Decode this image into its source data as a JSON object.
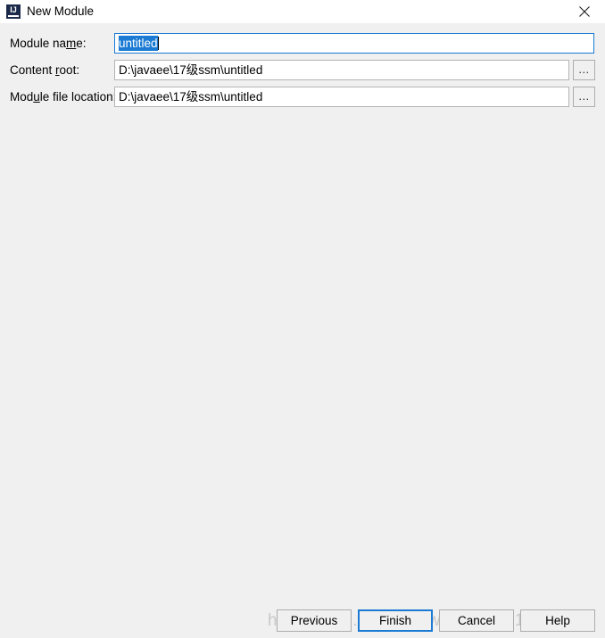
{
  "window": {
    "title": "New Module",
    "icon": "intellij-idea-icon",
    "icon_text": "IJ",
    "close_icon": "close-icon",
    "background_color": "#f0f0f0",
    "titlebar_color": "#ffffff",
    "accent_color": "#1a7ad4"
  },
  "form": {
    "rows": [
      {
        "label_prefix": "Module na",
        "label_mnemonic": "m",
        "label_suffix": "e:",
        "value": "untitled",
        "value_selected": true,
        "focused": true,
        "has_browse": false,
        "browse_label": ""
      },
      {
        "label_prefix": "Content ",
        "label_mnemonic": "r",
        "label_suffix": "oot:",
        "value": "D:\\javaee\\17级ssm\\untitled",
        "value_selected": false,
        "focused": false,
        "has_browse": true,
        "browse_label": "..."
      },
      {
        "label_prefix": "Mod",
        "label_mnemonic": "u",
        "label_suffix": "le file location:",
        "value": "D:\\javaee\\17级ssm\\untitled",
        "value_selected": false,
        "focused": false,
        "has_browse": true,
        "browse_label": "..."
      }
    ]
  },
  "footer": {
    "buttons": [
      {
        "label": "Previous",
        "default": false
      },
      {
        "label": "Finish",
        "default": true
      },
      {
        "label": "Cancel",
        "default": false
      },
      {
        "label": "Help",
        "default": false
      }
    ]
  },
  "watermark": {
    "text": "https://blog.csdn.net/weixin_44418154"
  }
}
